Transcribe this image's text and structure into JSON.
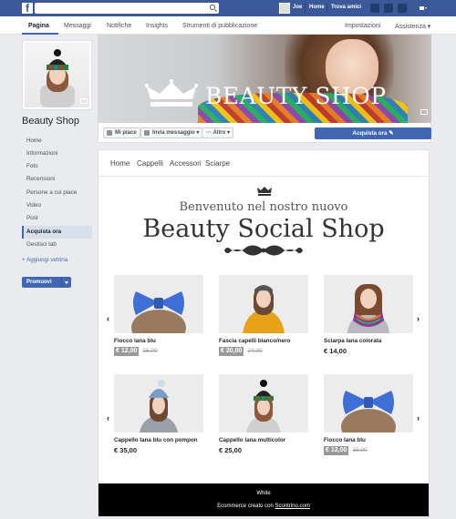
{
  "topbar": {
    "logo": "f",
    "user_name": "Joe",
    "links": [
      "Home",
      "Trova amici"
    ]
  },
  "tabs": {
    "left": [
      "Pagina",
      "Messaggi",
      "Notifiche",
      "Insights",
      "Strumenti di pubblicazione"
    ],
    "right": [
      "Impostazioni",
      "Assistenza ▾"
    ]
  },
  "sidebar": {
    "page_name": "Beauty Shop",
    "items": [
      "Home",
      "Informazioni",
      "Foto",
      "Recensioni",
      "Persone a cui piace",
      "Video",
      "Post",
      "Acquista ora",
      "Gestisci tab"
    ],
    "add_shop": "+ Aggiungi vetrina",
    "promote": "Promuovi"
  },
  "cover": {
    "title": "BEAUTY SHOP"
  },
  "actions": {
    "like": "Mi piace",
    "message": "Invia messaggio ▾",
    "more": "··· Altro ▾",
    "buy": "Acquista ora ✎"
  },
  "shop": {
    "nav": [
      "Home",
      "Cappelli",
      "Accessori",
      "Sciarpe"
    ],
    "welcome": "Benvenuto nel nostro nuovo",
    "title": "Beauty Social Shop",
    "products": [
      {
        "name": "Fiocco lana blu",
        "sale": "€ 12,00",
        "old": "15,00",
        "price": ""
      },
      {
        "name": "Fascia capelli bianco/nero",
        "sale": "€ 20,00",
        "old": "24,00",
        "price": ""
      },
      {
        "name": "Sciarpa lana colorata",
        "sale": "",
        "old": "",
        "price": "€  14,00"
      },
      {
        "name": "Cappello lana blu con pompon",
        "sale": "",
        "old": "",
        "price": "€  35,00"
      },
      {
        "name": "Cappello lana multicolor",
        "sale": "",
        "old": "",
        "price": "€  25,00"
      },
      {
        "name": "Fiocco lana blu",
        "sale": "€ 12,00",
        "old": "15,00",
        "price": ""
      }
    ],
    "footer_title": "White",
    "footer_text": "Ecommerce creato con ",
    "footer_link": "Scontrino.com"
  },
  "colors": {
    "fb_blue": "#3b5998",
    "button_blue": "#4267b2",
    "product_blue": "#3f6fd6"
  }
}
